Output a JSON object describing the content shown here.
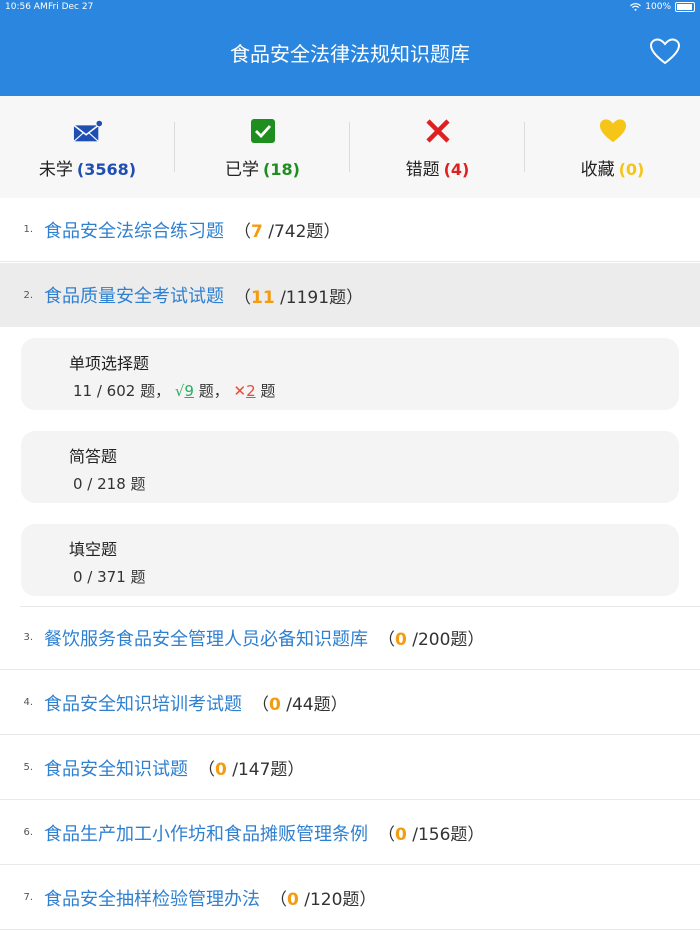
{
  "status": {
    "time": "10:56 AM",
    "date": "Fri Dec 27",
    "battery": "100%"
  },
  "header": {
    "title": "食品安全法律法规知识题库"
  },
  "stats": [
    {
      "label": "未学",
      "count": "(3568)",
      "color": "#1f4fb3",
      "icon": "envelope-icon"
    },
    {
      "label": "已学",
      "count": "(18)",
      "color": "#1e8f1e",
      "icon": "check-icon"
    },
    {
      "label": "错题",
      "count": "(4)",
      "color": "#e02020",
      "icon": "cross-icon"
    },
    {
      "label": "收藏",
      "count": "(0)",
      "color": "#f5c518",
      "icon": "heart-icon"
    }
  ],
  "exams": [
    {
      "num": "1.",
      "title": "食品安全法综合练习题",
      "open": "（",
      "done": "7",
      "total": " /742题）"
    },
    {
      "num": "2.",
      "title": "食品质量安全考试试题",
      "open": "（",
      "done": "11",
      "total": " /1191题）"
    },
    {
      "num": "3.",
      "title": "餐饮服务食品安全管理人员必备知识题库",
      "open": "（",
      "done": "0",
      "total": " /200题）"
    },
    {
      "num": "4.",
      "title": "食品安全知识培训考试题",
      "open": "（",
      "done": "0",
      "total": " /44题）"
    },
    {
      "num": "5.",
      "title": "食品安全知识试题",
      "open": "（",
      "done": "0",
      "total": " /147题）"
    },
    {
      "num": "6.",
      "title": "食品生产加工小作坊和食品摊贩管理条例",
      "open": "（",
      "done": "0",
      "total": " /156题）"
    },
    {
      "num": "7.",
      "title": "食品安全抽样检验管理办法",
      "open": "（",
      "done": "0",
      "total": " /120题）"
    }
  ],
  "subsections": [
    {
      "title": "单项选择题",
      "progress": "11 / 602 题，",
      "right_mark": "√",
      "right": "9",
      "right_suffix": " 题，",
      "wrong_mark": "✕",
      "wrong": "2",
      "wrong_suffix": " 题"
    },
    {
      "title": "简答题",
      "progress": "0 / 218 题"
    },
    {
      "title": "填空题",
      "progress": "0 / 371 题"
    }
  ]
}
